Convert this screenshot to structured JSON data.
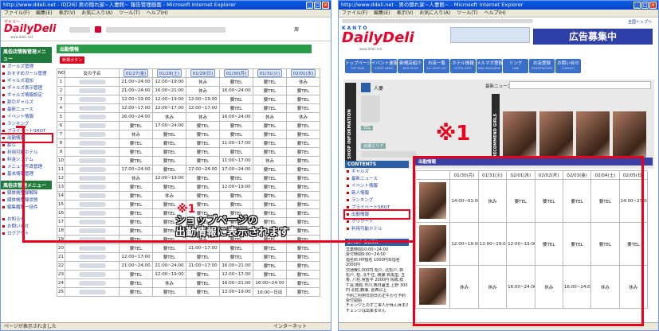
{
  "left_window": {
    "title": "http://www.ddeli.net - ID[26] 男の隠れ家~人妻館~ 報告管理画面 - Microsoft Internet Explorer",
    "menu": [
      "ファイル(F)",
      "編集(E)",
      "表示(V)",
      "お気に入り(A)",
      "ツール(T)",
      "ヘルプ(H)"
    ],
    "brand_small": "デイリー",
    "brand": "DailyDeli",
    "brand_url": "www.ddeli.net",
    "sidebar": {
      "section1": "風俗店情報管理メニュー",
      "items1": [
        "ガールズ管理",
        "おすすめガール管理",
        "ギャルズ追加",
        "ギャルズ表示管理",
        "ギャルズ情報設定",
        "割引ギャルズ",
        "最新ニュース",
        "イベント情報",
        "ランキング",
        "プライベートSHOT",
        "出勤情報",
        "割引",
        "利用可能ホテル",
        "料金システム",
        "メニュー写真管理",
        "基本情報管理"
      ],
      "section2": "風俗店管理メニュー",
      "items2": [
        "媒体側登録解除",
        "媒体側登録状態",
        "編集履歴一括件"
      ],
      "items3": [
        "お知らせ",
        "お問い合せ",
        "ログアウト"
      ]
    },
    "section_title": "出勤情報",
    "register_button": "新規ボタン",
    "table": {
      "col_no": "NO",
      "col_name": "女の子名",
      "dates": [
        "01/27(金)",
        "01/28(土)",
        "01/29(日)",
        "01/30(月)",
        "01/31(火)",
        "02/01(水)"
      ],
      "rows": [
        [
          "1",
          "21:00~24:00",
          "12:00~19:00",
          "休み",
          "要TEL",
          "要TEL",
          "休み"
        ],
        [
          "2",
          "21:00~24:00",
          "16:00~21:00",
          "休み",
          "16:00~24:00",
          "要TEL",
          "要TEL"
        ],
        [
          "3",
          "12:00~19:00",
          "12:00~19:00",
          "12:00~19:00",
          "要TEL",
          "要TEL",
          "要TEL"
        ],
        [
          "4",
          "12:00~17:00",
          "12:00~17:00",
          "12:00~17:00",
          "要TEL",
          "要TEL",
          "要TEL"
        ],
        [
          "5",
          "16:00~24:00",
          "休み",
          "休み",
          "16:00~24:00",
          "休み",
          "休み"
        ],
        [
          "6",
          "要TEL",
          "17:00~24:00",
          "要TEL",
          "要TEL",
          "要TEL",
          "要TEL"
        ],
        [
          "7",
          "休み",
          "要TEL",
          "要TEL",
          "要TEL",
          "要TEL",
          "要TEL"
        ],
        [
          "8",
          "要TEL",
          "要TEL",
          "要TEL",
          "11:00~17:00",
          "要TEL",
          "要TEL"
        ],
        [
          "9",
          "要TEL",
          "要TEL",
          "要TEL",
          "要TEL",
          "要TEL",
          "要TEL"
        ],
        [
          "10",
          "要TEL",
          "要TEL",
          "要TEL",
          "11:00~17:00",
          "休み",
          "要TEL"
        ],
        [
          "11",
          "17:00~24:00",
          "要TEL",
          "17:00~24:00",
          "17:00~24:00",
          "要TEL",
          "要TEL"
        ],
        [
          "12",
          "休み",
          "12:00~19:00",
          "要TEL",
          "要TEL",
          "要TEL",
          "要TEL"
        ],
        [
          "13",
          "要TEL",
          "要TEL",
          "要TEL",
          "12:00~19:00",
          "要TEL",
          "要TEL"
        ],
        [
          "14",
          "要TEL",
          "休み",
          "要TEL",
          "要TEL",
          "要TEL",
          "要TEL"
        ],
        [
          "15",
          "要TEL",
          "要TEL",
          "要TEL",
          "要TEL",
          "要TEL",
          "要TEL"
        ],
        [
          "16",
          "要TEL",
          "要TEL",
          "要TEL",
          "要TEL",
          "要TEL",
          "要TEL"
        ],
        [
          "17",
          "要TEL",
          "要TEL",
          "要TEL",
          "要TEL",
          "要TEL",
          "要TEL"
        ],
        [
          "18",
          "要TEL",
          "要TEL",
          "要TEL",
          "要TEL",
          "要TEL",
          "要TEL"
        ],
        [
          "19",
          "要TEL",
          "要TEL",
          "休み",
          "要TEL",
          "要TEL",
          "要TEL"
        ],
        [
          "20",
          "要TEL",
          "要TEL",
          "11:00~17:00",
          "要TEL",
          "要TEL",
          "要TEL"
        ],
        [
          "21",
          "12:00~17:00",
          "要TEL",
          "要TEL",
          "要TEL",
          "要TEL",
          "要TEL"
        ],
        [
          "22",
          "21:00~24:00",
          "21:00~24:00",
          "11:00~17:00",
          "16:00~21:00",
          "要TEL",
          "要TEL"
        ],
        [
          "23",
          "要TEL",
          "12:00~19:00",
          "要TEL",
          "12:00~17:00",
          "要TEL",
          "要TEL"
        ],
        [
          "24",
          "要TEL",
          "休み",
          "要TEL",
          "16:00~21:00",
          "16:00~24:00",
          "要TEL"
        ],
        [
          "25",
          "要TEL",
          "要TEL",
          "要TEL",
          "13:00~19:00",
          "16:00~日出",
          "要TEL"
        ]
      ]
    },
    "status": "ページが表示されました",
    "zone": "インターネット"
  },
  "right_window": {
    "title": "http://www.ddeli.net - 男の隠れ家~人妻館~ - Microsoft Internet Explorer",
    "menu": [
      "ファイル(F)",
      "編集(E)",
      "表示(V)",
      "お気に入り(A)",
      "ツール(T)",
      "ヘルプ(H)"
    ],
    "top_link": "全国トップへ",
    "brand_kanto": "KANTO",
    "brand": "DailyDeli",
    "brand_url": "www.ddeli.net",
    "ad_text": "広告募集中",
    "nav": [
      {
        "label": "トップページ",
        "sub": "TOP PAGE"
      },
      {
        "label": "イベント速報",
        "sub": "EVENT NEWS"
      },
      {
        "label": "新規店紹介",
        "sub": "NEW SHOP"
      },
      {
        "label": "お店一覧",
        "sub": "ALL SHOP LIST"
      },
      {
        "label": "ホテル情報",
        "sub": "HOTEL INFO"
      },
      {
        "label": "メルマガ登録",
        "sub": "MAIL MAGAZINE"
      },
      {
        "label": "リンク",
        "sub": "LINK"
      },
      {
        "label": "お店登録",
        "sub": "REGISTRATION"
      },
      {
        "label": "お問い合せ",
        "sub": "CONTACT"
      }
    ],
    "shop_info_label": "SHOP INFORMATION",
    "shop_type": "人妻",
    "tel_label": "TEL",
    "area_label": "派遣エリア",
    "news_label": "最新ニュース",
    "recommend_label": "RECOMMEND GIRLS",
    "contents_label": "CONTENTS",
    "contents": [
      "ギャルズ",
      "最新ニュース",
      "イベント情報",
      "新人情報",
      "ランキング",
      "プライベートSHOT",
      "出勤情報",
      "クリクート",
      "利用可能ホテル"
    ],
    "shop_data_label": "SHOP DATA",
    "shop_data_lines": [
      "営業時間10:00~24:00",
      "受付時間9:00~24:00",
      "指名料:HP指名 1000円本指名",
      "2000円",
      "交通費1,000円 松戸, 北松戸, 新",
      "松戸, 柏, 北千住, 綾瀬 目黒里, 五",
      "香, 八柱,常盤平 2000円 馬橋,稔",
      "ケ谷,南柏 市川,西日暮里,上野 3000",
      "円 北柏,鶴瀬, 葛西以上",
      "予約ご利用日前日の正午から予約",
      "受付開始",
      "チェンジとのずご来人が休ん休まので",
      "チェンジは出来ません"
    ],
    "schedule_title": "出勤情報",
    "schedule_dates": [
      "01/30(月)",
      "01/31(火)",
      "02/01(水)",
      "02/02(木)",
      "02/03(金)",
      "02/04(土)",
      "02/05(日)"
    ],
    "schedule_rows": [
      [
        "14:00~01:00",
        "休み",
        "要TEL",
        "要TEL",
        "要TEL",
        "要TEL",
        "14:00~23:00"
      ],
      [
        "12:00~19:00",
        "12:00~19:00",
        "12:00~19:00",
        "要TEL",
        "要TEL",
        "要TEL",
        "要TEL"
      ],
      [
        "休み",
        "休み",
        "16:00~24:00",
        "休み",
        "16:00~24:00",
        "休み",
        "休み"
      ]
    ]
  },
  "annotation": {
    "marker": "※1",
    "line1": "ショップページの",
    "line2": "出勤情報に表示されます",
    "color": "#e8001c"
  }
}
